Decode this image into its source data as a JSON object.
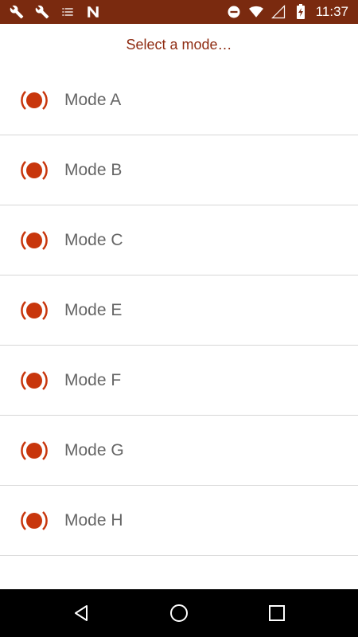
{
  "status_bar": {
    "left_icons": [
      "wrench-icon",
      "wrench-icon",
      "list-icon",
      "n-notification-icon"
    ],
    "right_icons": [
      "do-not-disturb-icon",
      "wifi-icon",
      "cellular-signal-icon",
      "battery-charging-icon"
    ],
    "time": "11:37",
    "background_color": "#7a2a0f"
  },
  "header": {
    "title": "Select a mode…",
    "color": "#8e2a10"
  },
  "modes": [
    {
      "label": "Mode A",
      "icon": "mode-radar-icon"
    },
    {
      "label": "Mode B",
      "icon": "mode-radar-icon"
    },
    {
      "label": "Mode C",
      "icon": "mode-radar-icon"
    },
    {
      "label": "Mode E",
      "icon": "mode-radar-icon"
    },
    {
      "label": "Mode F",
      "icon": "mode-radar-icon"
    },
    {
      "label": "Mode G",
      "icon": "mode-radar-icon"
    },
    {
      "label": "Mode H",
      "icon": "mode-radar-icon"
    }
  ],
  "icon_color": "#c8360c",
  "nav_bar": {
    "buttons": [
      "back-icon",
      "home-icon",
      "recents-icon"
    ]
  }
}
